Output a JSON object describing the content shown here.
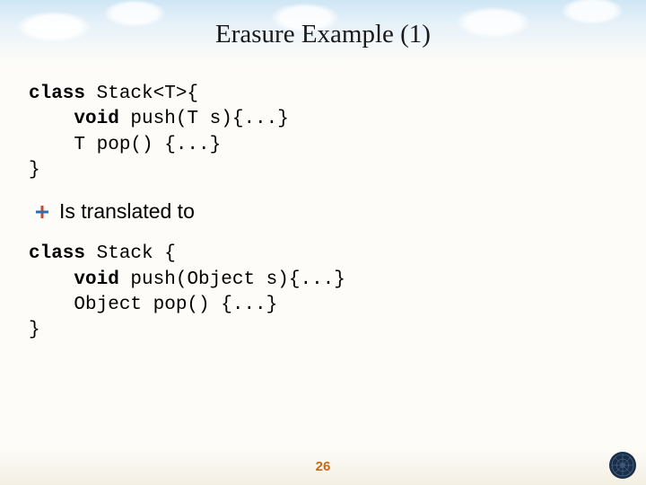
{
  "title": "Erasure Example (1)",
  "code_block_1": {
    "line1_a": "class",
    "line1_b": " Stack<T>{",
    "line2_a": "    void",
    "line2_b": " push(T s){...}",
    "line3": "    T pop() {...}",
    "line4": "}"
  },
  "bullet": {
    "text": "Is translated to"
  },
  "code_block_2": {
    "line1_a": "class",
    "line1_b": " Stack {",
    "line2_a": "    void",
    "line2_b": " push(Object s){...}",
    "line3": "    Object pop() {...}",
    "line4": "}"
  },
  "page_number": "26"
}
